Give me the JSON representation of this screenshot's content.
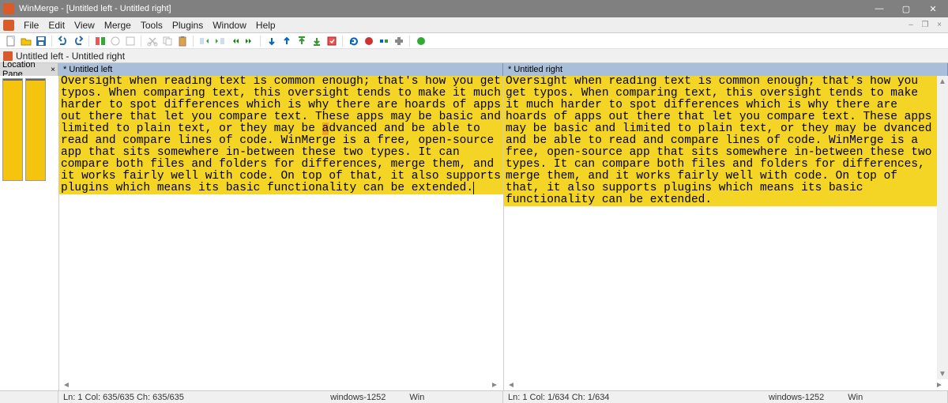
{
  "window": {
    "title": "WinMerge - [Untitled left - Untitled right]"
  },
  "menu": {
    "items": [
      "File",
      "Edit",
      "View",
      "Merge",
      "Tools",
      "Plugins",
      "Window",
      "Help"
    ]
  },
  "doc_tab": {
    "label": "Untitled left - Untitled right"
  },
  "location_pane": {
    "header": "Location Pane"
  },
  "panes": {
    "left": {
      "header": "* Untitled left",
      "text_pre": "Oversight when reading text is common enough; that's how you get typos. When comparing text, this oversight tends to make it much harder to spot differences which is why there are hoards of apps out there that let you compare text. These apps may be basic and limited to plain text, or they may be ",
      "diff_char": "a",
      "text_post": "dvanced and be able to read and compare lines of code. WinMerge is a free, open-source app that sits somewhere in-between these two types. It can compare both files and folders for differences, merge them, and it works fairly well with code. On top of that, it also supports plugins which means its basic functionality can be extended."
    },
    "right": {
      "header": "* Untitled right",
      "text": "Oversight when reading text is common enough; that's how you get typos. When comparing text, this oversight tends to make it much harder to spot differences which is why there are hoards of apps out there that let you compare text. These apps may be basic and limited to plain text, or they may be dvanced and be able to read and compare lines of code. WinMerge is a free, open-source app that sits somewhere in-between these two types. It can compare both files and folders for differences, merge them, and it works fairly well with code. On top of that, it also supports plugins which means its basic functionality can be extended."
    }
  },
  "status": {
    "left": {
      "pos": "Ln: 1  Col: 635/635  Ch: 635/635",
      "enc": "windows-1252",
      "eol": "Win"
    },
    "right": {
      "pos": "Ln: 1  Col: 1/634  Ch: 1/634",
      "enc": "windows-1252",
      "eol": "Win"
    }
  },
  "icons": {
    "new": "new-file-icon",
    "open": "open-folder-icon",
    "save": "save-icon",
    "undo": "undo-icon",
    "redo": "redo-icon"
  }
}
